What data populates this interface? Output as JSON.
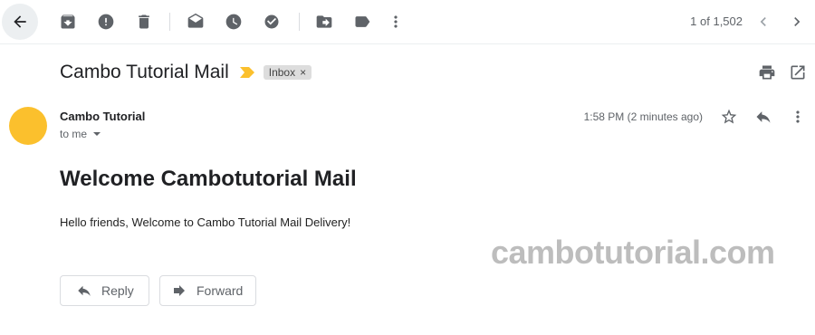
{
  "toolbar": {
    "counter": "1 of 1,502",
    "icons": [
      "back-arrow-icon",
      "archive-icon",
      "report-spam-icon",
      "delete-icon",
      "mark-unread-icon",
      "snooze-icon",
      "add-to-tasks-icon",
      "move-to-icon",
      "label-icon",
      "more-vert-icon",
      "chevron-left-icon",
      "chevron-right-icon"
    ]
  },
  "email": {
    "subject": "Cambo Tutorial Mail",
    "label_chip": "Inbox",
    "label_chip_close": "×",
    "sender": "Cambo Tutorial",
    "to_line": "to me",
    "time": "1:58 PM (2 minutes ago)",
    "heading": "Welcome Cambotutorial Mail",
    "body": "Hello friends, Welcome to Cambo Tutorial Mail Delivery!"
  },
  "watermark": "cambotutorial.com",
  "actions": {
    "reply": "Reply",
    "forward": "Forward"
  },
  "colors": {
    "avatar": "#fbc02d",
    "importance_marker": "#fbc02d",
    "icon": "#5f6368"
  }
}
